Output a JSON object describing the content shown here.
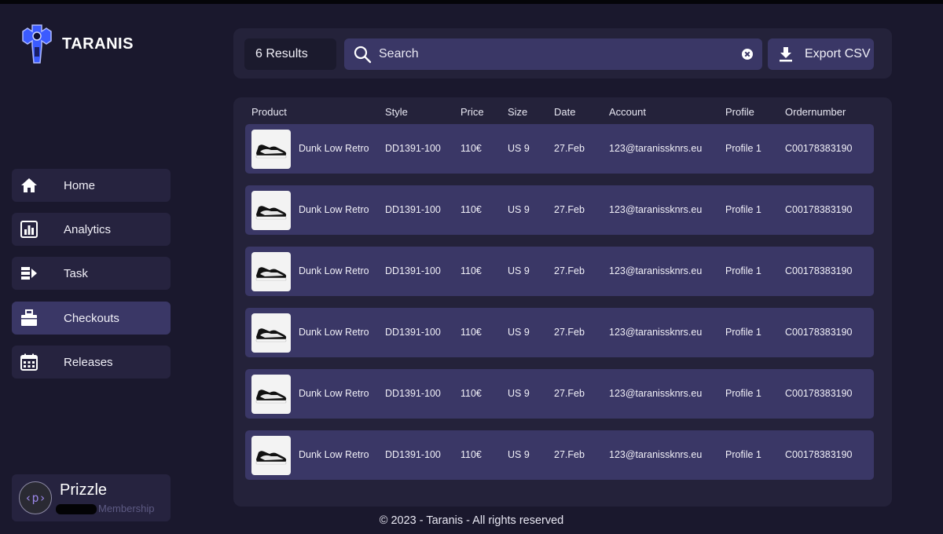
{
  "brand": {
    "name": "TARANIS"
  },
  "sidebar": {
    "items": [
      {
        "label": "Home",
        "icon": "home-icon",
        "active": false
      },
      {
        "label": "Analytics",
        "icon": "analytics-icon",
        "active": false
      },
      {
        "label": "Task",
        "icon": "task-icon",
        "active": false
      },
      {
        "label": "Checkouts",
        "icon": "checkouts-icon",
        "active": true
      },
      {
        "label": "Releases",
        "icon": "calendar-icon",
        "active": false
      }
    ]
  },
  "profile": {
    "avatar_text": "‹p›",
    "name": "Prizzle",
    "membership": "Membership"
  },
  "toolbar": {
    "results": "6 Results",
    "search_placeholder": "Search",
    "export_label": "Export CSV"
  },
  "table": {
    "columns": [
      "Product",
      "Style",
      "Price",
      "Size",
      "Date",
      "Account",
      "Profile",
      "Ordernumber"
    ],
    "rows": [
      {
        "product": "Dunk Low Retro",
        "style": "DD1391-100",
        "price": "110€",
        "size": "US 9",
        "date": "27.Feb",
        "account": "123@taranissknrs.eu",
        "profile": "Profile 1",
        "order": "C00178383190"
      },
      {
        "product": "Dunk Low Retro",
        "style": "DD1391-100",
        "price": "110€",
        "size": "US 9",
        "date": "27.Feb",
        "account": "123@taranissknrs.eu",
        "profile": "Profile 1",
        "order": "C00178383190"
      },
      {
        "product": "Dunk Low Retro",
        "style": "DD1391-100",
        "price": "110€",
        "size": "US 9",
        "date": "27.Feb",
        "account": "123@taranissknrs.eu",
        "profile": "Profile 1",
        "order": "C00178383190"
      },
      {
        "product": "Dunk Low Retro",
        "style": "DD1391-100",
        "price": "110€",
        "size": "US 9",
        "date": "27.Feb",
        "account": "123@taranissknrs.eu",
        "profile": "Profile 1",
        "order": "C00178383190"
      },
      {
        "product": "Dunk Low Retro",
        "style": "DD1391-100",
        "price": "110€",
        "size": "US 9",
        "date": "27.Feb",
        "account": "123@taranissknrs.eu",
        "profile": "Profile 1",
        "order": "C00178383190"
      },
      {
        "product": "Dunk Low Retro",
        "style": "DD1391-100",
        "price": "110€",
        "size": "US 9",
        "date": "27.Feb",
        "account": "123@taranissknrs.eu",
        "profile": "Profile 1",
        "order": "C00178383190"
      }
    ]
  },
  "footer": {
    "text": "© 2023 - Taranis - All rights reserved"
  }
}
